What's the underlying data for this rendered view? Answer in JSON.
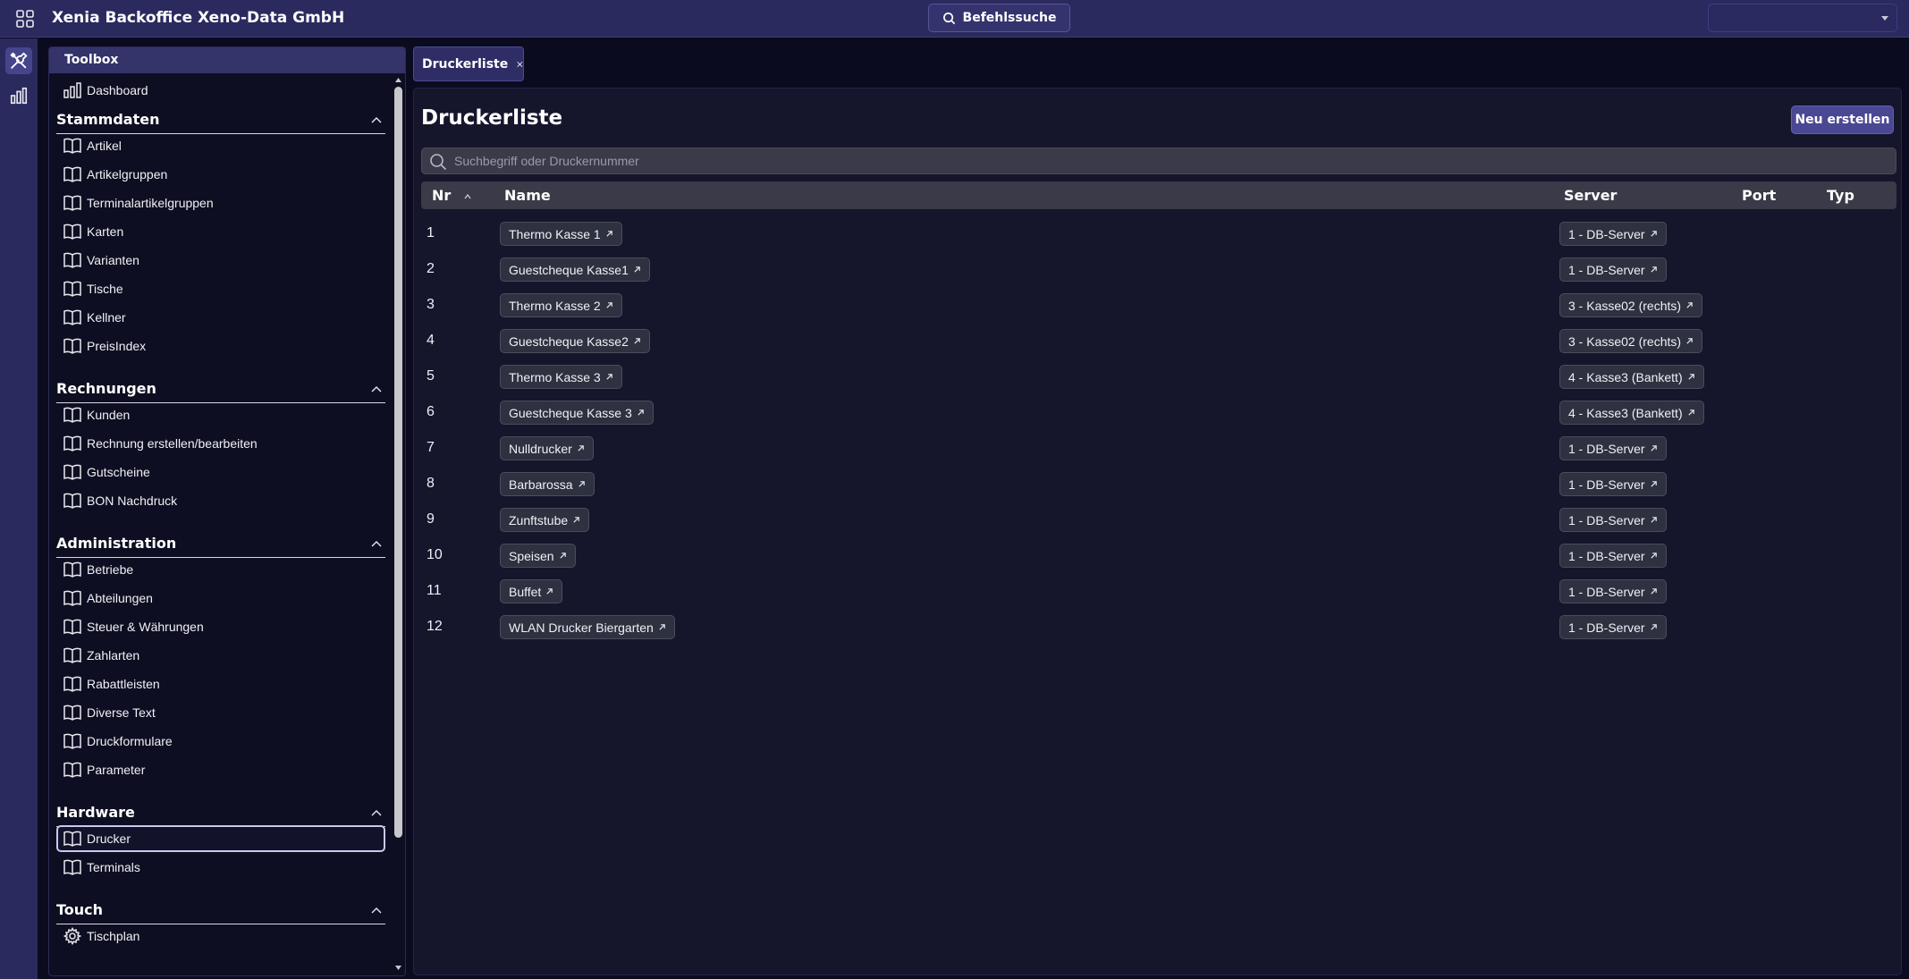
{
  "app": {
    "title": "Xenia Backoffice Xeno-Data GmbH",
    "command_search_label": "Befehlssuche"
  },
  "sidebar": {
    "title": "Toolbox",
    "top_item": "Dashboard",
    "sections": [
      {
        "title": "Stammdaten",
        "items": [
          "Artikel",
          "Artikelgruppen",
          "Terminalartikelgruppen",
          "Karten",
          "Varianten",
          "Tische",
          "Kellner",
          "PreisIndex"
        ]
      },
      {
        "title": "Rechnungen",
        "items": [
          "Kunden",
          "Rechnung erstellen/bearbeiten",
          "Gutscheine",
          "BON Nachdruck"
        ]
      },
      {
        "title": "Administration",
        "items": [
          "Betriebe",
          "Abteilungen",
          "Steuer & Währungen",
          "Zahlarten",
          "Rabattleisten",
          "Diverse Text",
          "Druckformulare",
          "Parameter"
        ]
      },
      {
        "title": "Hardware",
        "items": [
          "Drucker",
          "Terminals"
        ]
      },
      {
        "title": "Touch",
        "items": [
          "Tischplan"
        ]
      }
    ],
    "selected_item": "Drucker"
  },
  "tab": {
    "label": "Druckerliste"
  },
  "main": {
    "title": "Druckerliste",
    "new_button": "Neu erstellen",
    "search_placeholder": "Suchbegriff oder Druckernummer",
    "columns": {
      "nr": "Nr",
      "name": "Name",
      "server": "Server",
      "port": "Port",
      "typ": "Typ"
    },
    "rows": [
      {
        "nr": "1",
        "name": "Thermo Kasse 1",
        "server": "1 - DB-Server"
      },
      {
        "nr": "2",
        "name": "Guestcheque Kasse1",
        "server": "1 - DB-Server"
      },
      {
        "nr": "3",
        "name": "Thermo Kasse 2",
        "server": "3 - Kasse02 (rechts)"
      },
      {
        "nr": "4",
        "name": "Guestcheque Kasse2",
        "server": "3 - Kasse02 (rechts)"
      },
      {
        "nr": "5",
        "name": "Thermo Kasse 3",
        "server": "4 - Kasse3 (Bankett)"
      },
      {
        "nr": "6",
        "name": "Guestcheque Kasse 3",
        "server": "4 - Kasse3 (Bankett)"
      },
      {
        "nr": "7",
        "name": "Nulldrucker",
        "server": "1 - DB-Server"
      },
      {
        "nr": "8",
        "name": "Barbarossa",
        "server": "1 - DB-Server"
      },
      {
        "nr": "9",
        "name": "Zunftstube",
        "server": "1 - DB-Server"
      },
      {
        "nr": "10",
        "name": "Speisen",
        "server": "1 - DB-Server"
      },
      {
        "nr": "11",
        "name": "Buffet",
        "server": "1 - DB-Server"
      },
      {
        "nr": "12",
        "name": "WLAN Drucker Biergarten",
        "server": "1 - DB-Server"
      }
    ]
  }
}
